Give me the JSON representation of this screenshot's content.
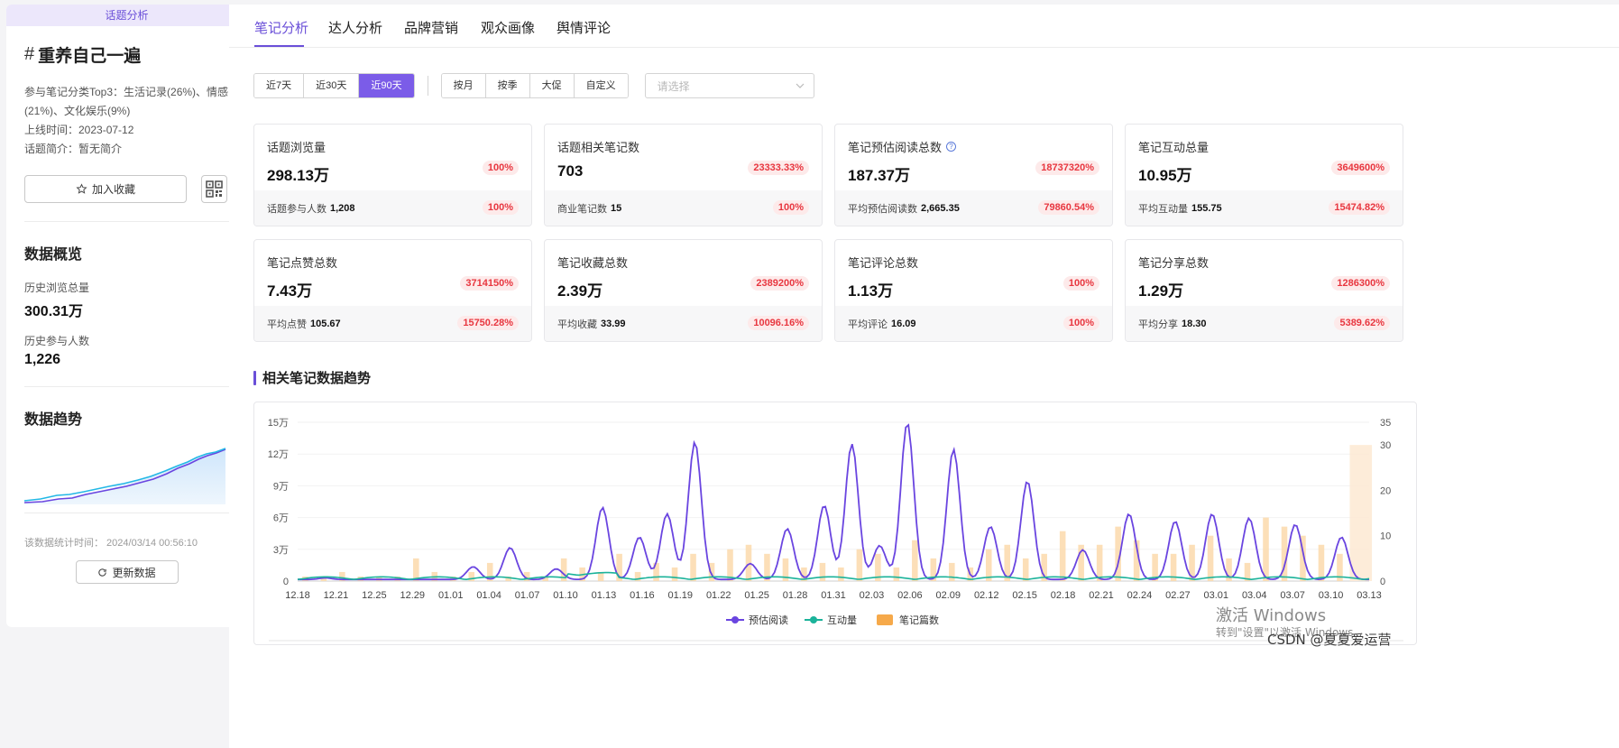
{
  "sidebar": {
    "badge": "话题分析",
    "hash": "#",
    "title": "重养自己一遍",
    "category_line": "参与笔记分类Top3：生活记录(26%)、情感(21%)、文化娱乐(9%)",
    "launch_time": "上线时间：2023-07-12",
    "intro": "话题简介：暂无简介",
    "favorite_label": "加入收藏",
    "overview_title": "数据概览",
    "history_views_label": "历史浏览总量",
    "history_views_value": "300.31万",
    "history_participants_label": "历史参与人数",
    "history_participants_value": "1,226",
    "trend_title": "数据趋势",
    "stats_time": "该数据统计时间：  2024/03/14 00:56:10",
    "refresh_label": "更新数据"
  },
  "tabs": [
    "笔记分析",
    "达人分析",
    "品牌营销",
    "观众画像",
    "舆情评论"
  ],
  "active_tab": 0,
  "range_filters": [
    "近7天",
    "近30天",
    "近90天"
  ],
  "active_range": 2,
  "period_filters": [
    "按月",
    "按季",
    "大促",
    "自定义"
  ],
  "select_placeholder": "请选择",
  "cards": [
    {
      "label": "话题浏览量",
      "value": "298.13万",
      "pct": "100%",
      "sub_label": "话题参与人数",
      "sub_value": "1,208",
      "sub_pct": "100%"
    },
    {
      "label": "话题相关笔记数",
      "value": "703",
      "pct": "23333.33%",
      "sub_label": "商业笔记数",
      "sub_value": "15",
      "sub_pct": "100%"
    },
    {
      "label": "笔记预估阅读总数",
      "value": "187.37万",
      "pct": "18737320%",
      "sub_label": "平均预估阅读数",
      "sub_value": "2,665.35",
      "sub_pct": "79860.54%",
      "help": "?"
    },
    {
      "label": "笔记互动总量",
      "value": "10.95万",
      "pct": "3649600%",
      "sub_label": "平均互动量",
      "sub_value": "155.75",
      "sub_pct": "15474.82%"
    },
    {
      "label": "笔记点赞总数",
      "value": "7.43万",
      "pct": "3714150%",
      "sub_label": "平均点赞",
      "sub_value": "105.67",
      "sub_pct": "15750.28%"
    },
    {
      "label": "笔记收藏总数",
      "value": "2.39万",
      "pct": "2389200%",
      "sub_label": "平均收藏",
      "sub_value": "33.99",
      "sub_pct": "10096.16%"
    },
    {
      "label": "笔记评论总数",
      "value": "1.13万",
      "pct": "100%",
      "sub_label": "平均评论",
      "sub_value": "16.09",
      "sub_pct": "100%"
    },
    {
      "label": "笔记分享总数",
      "value": "1.29万",
      "pct": "1286300%",
      "sub_label": "平均分享",
      "sub_value": "18.30",
      "sub_pct": "5389.62%"
    }
  ],
  "section_title": "相关笔记数据趋势",
  "watermark": {
    "line1": "激活 Windows",
    "line2": "转到\"设置\"以激活 Windows。",
    "csdn": "CSDN @夏夏爱运营"
  },
  "colors": {
    "accent": "#6a4fd8",
    "read": "#6a45e0",
    "interact": "#1bb39a",
    "notes": "#fbd9ac",
    "pill_text": "#e8363f"
  },
  "chart_data": {
    "type": "line",
    "x_tick_labels": [
      "12.18",
      "12.21",
      "12.25",
      "12.29",
      "01.01",
      "01.04",
      "01.07",
      "01.10",
      "01.13",
      "01.16",
      "01.19",
      "01.22",
      "01.25",
      "01.28",
      "01.31",
      "02.03",
      "02.06",
      "02.09",
      "02.12",
      "02.15",
      "02.18",
      "02.21",
      "02.24",
      "02.27",
      "03.01",
      "03.04",
      "03.07",
      "03.10",
      "03.13"
    ],
    "y_left_ticks": [
      "0",
      "3万",
      "6万",
      "9万",
      "12万",
      "15万"
    ],
    "y_left_max": 150000,
    "y_right_ticks": [
      "0",
      "10",
      "20",
      "30",
      "35"
    ],
    "y_right_max": 35,
    "legend": [
      "预估阅读",
      "互动量",
      "笔记篇数"
    ],
    "legend_position": "bottom-center",
    "series": [
      {
        "name": "预估阅读",
        "axis": "left",
        "style": "smooth-line",
        "peaks": [
          [
            0.1,
            1500
          ],
          [
            0.26,
            12000
          ],
          [
            0.3,
            30000
          ],
          [
            0.35,
            10000
          ],
          [
            0.4,
            68000
          ],
          [
            0.44,
            40000
          ],
          [
            0.47,
            62000
          ],
          [
            0.5,
            130000
          ],
          [
            0.56,
            15000
          ],
          [
            0.6,
            48000
          ],
          [
            0.64,
            70000
          ],
          [
            0.67,
            128000
          ],
          [
            0.7,
            32000
          ],
          [
            0.73,
            148000
          ],
          [
            0.78,
            123000
          ],
          [
            0.82,
            50000
          ],
          [
            0.86,
            93000
          ],
          [
            0.92,
            28000
          ],
          [
            0.97,
            62000
          ],
          [
            1.02,
            55000
          ],
          [
            1.06,
            62000
          ],
          [
            1.1,
            58000
          ],
          [
            1.15,
            52000
          ],
          [
            1.2,
            40000
          ]
        ]
      },
      {
        "name": "互动量",
        "axis": "left",
        "style": "smooth-line",
        "values": "low wave ≈ 1000–8000"
      },
      {
        "name": "笔记篇数",
        "axis": "right",
        "style": "bar",
        "values": [
          1,
          1,
          2,
          1,
          1,
          1,
          5,
          2,
          1,
          2,
          4,
          1,
          2,
          1,
          5,
          3,
          2,
          6,
          2,
          4,
          3,
          6,
          4,
          7,
          8,
          6,
          5,
          3,
          4,
          3,
          7,
          6,
          3,
          9,
          5,
          4,
          3,
          7,
          8,
          5,
          6,
          11,
          8,
          8,
          12,
          9,
          6,
          6,
          8,
          10,
          5,
          4,
          14,
          12,
          10,
          8,
          6,
          30
        ]
      }
    ]
  }
}
